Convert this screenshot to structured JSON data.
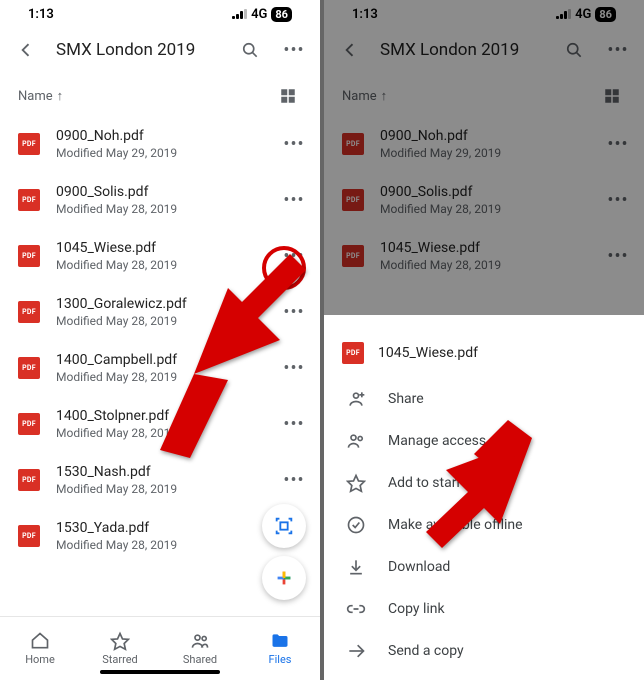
{
  "status": {
    "time": "1:13",
    "network": "4G",
    "battery": "86"
  },
  "header": {
    "title": "SMX London 2019"
  },
  "sort": {
    "label": "Name",
    "dir": "↑"
  },
  "mod_prefix": "Modified",
  "files": [
    {
      "name": "0900_Noh.pdf",
      "mod": "May 29, 2019"
    },
    {
      "name": "0900_Solis.pdf",
      "mod": "May 28, 2019"
    },
    {
      "name": "1045_Wiese.pdf",
      "mod": "May 28, 2019"
    },
    {
      "name": "1300_Goralewicz.pdf",
      "mod": "May 28, 2019"
    },
    {
      "name": "1400_Campbell.pdf",
      "mod": "May 28, 2019"
    },
    {
      "name": "1400_Stolpner.pdf",
      "mod": "May 28, 2019"
    },
    {
      "name": "1530_Nash.pdf",
      "mod": "May 28, 2019"
    },
    {
      "name": "1530_Yada.pdf",
      "mod": "May 28, 2019"
    }
  ],
  "nav": {
    "home": "Home",
    "starred": "Starred",
    "shared": "Shared",
    "files": "Files"
  },
  "pdf_badge": "PDF",
  "sheet": {
    "file": "1045_Wiese.pdf",
    "share": "Share",
    "manage": "Manage access",
    "star": "Add to starred",
    "offline": "Make available offline",
    "download": "Download",
    "copylink": "Copy link",
    "sendcopy": "Send a copy"
  }
}
